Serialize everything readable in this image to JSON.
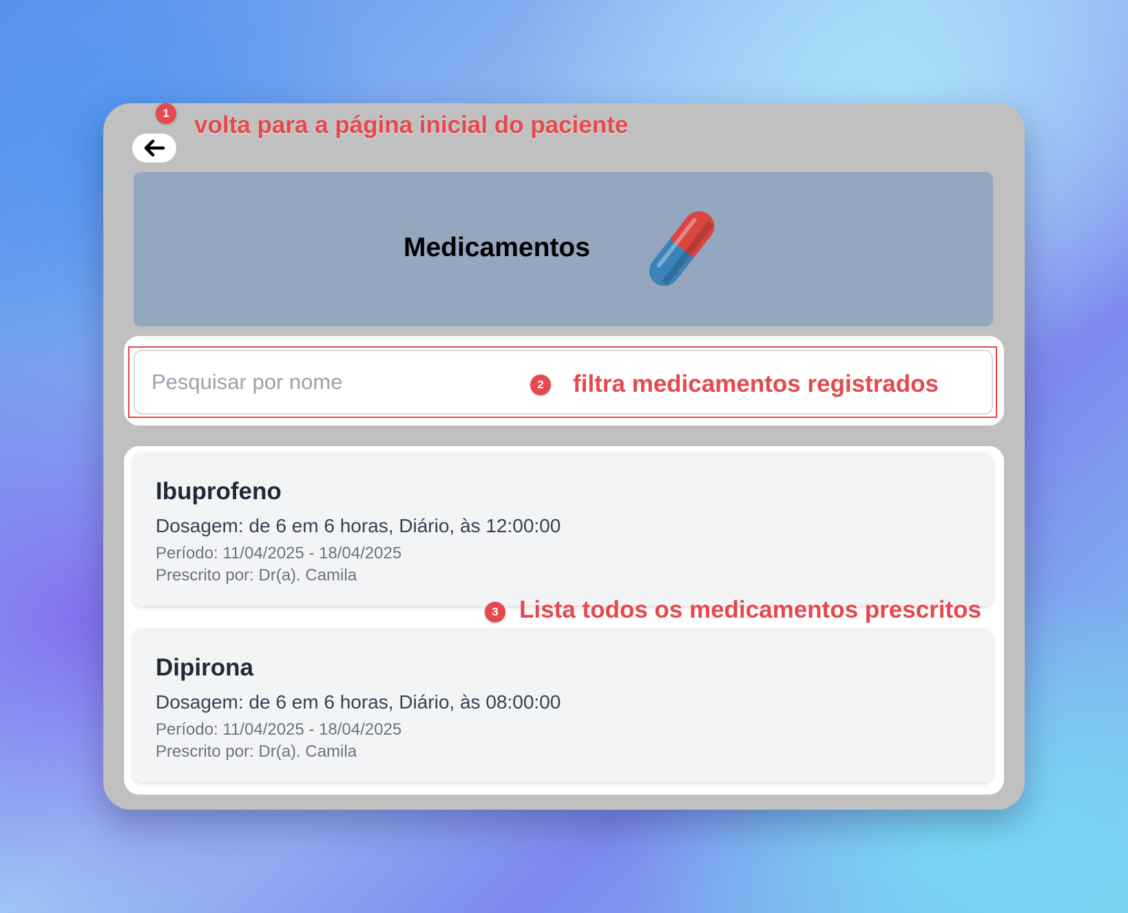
{
  "annotations": [
    {
      "number": "1",
      "text": "volta para a página inicial do paciente"
    },
    {
      "number": "2",
      "text": "filtra medicamentos registrados"
    },
    {
      "number": "3",
      "text": "Lista todos os medicamentos prescritos"
    }
  ],
  "header": {
    "title": "Medicamentos",
    "icon": "pill-icon"
  },
  "back_button": {
    "icon": "arrow-left-icon"
  },
  "search": {
    "placeholder": "Pesquisar por nome",
    "value": ""
  },
  "medications": [
    {
      "name": "Ibuprofeno",
      "dosage": "Dosagem: de 6 em 6 horas, Diário, às 12:00:00",
      "period": "Período: 11/04/2025 - 18/04/2025",
      "prescriber": "Prescrito por: Dr(a). Camila"
    },
    {
      "name": "Dipirona",
      "dosage": "Dosagem: de 6 em 6 horas, Diário, às 08:00:00",
      "period": "Período: 11/04/2025 - 18/04/2025",
      "prescriber": "Prescrito por: Dr(a). Camila"
    }
  ],
  "colors": {
    "annotation": "#e5484d",
    "window_bg": "#c0c0c0",
    "header_bg": "#95a7bf",
    "card_bg": "#f3f4f6"
  }
}
